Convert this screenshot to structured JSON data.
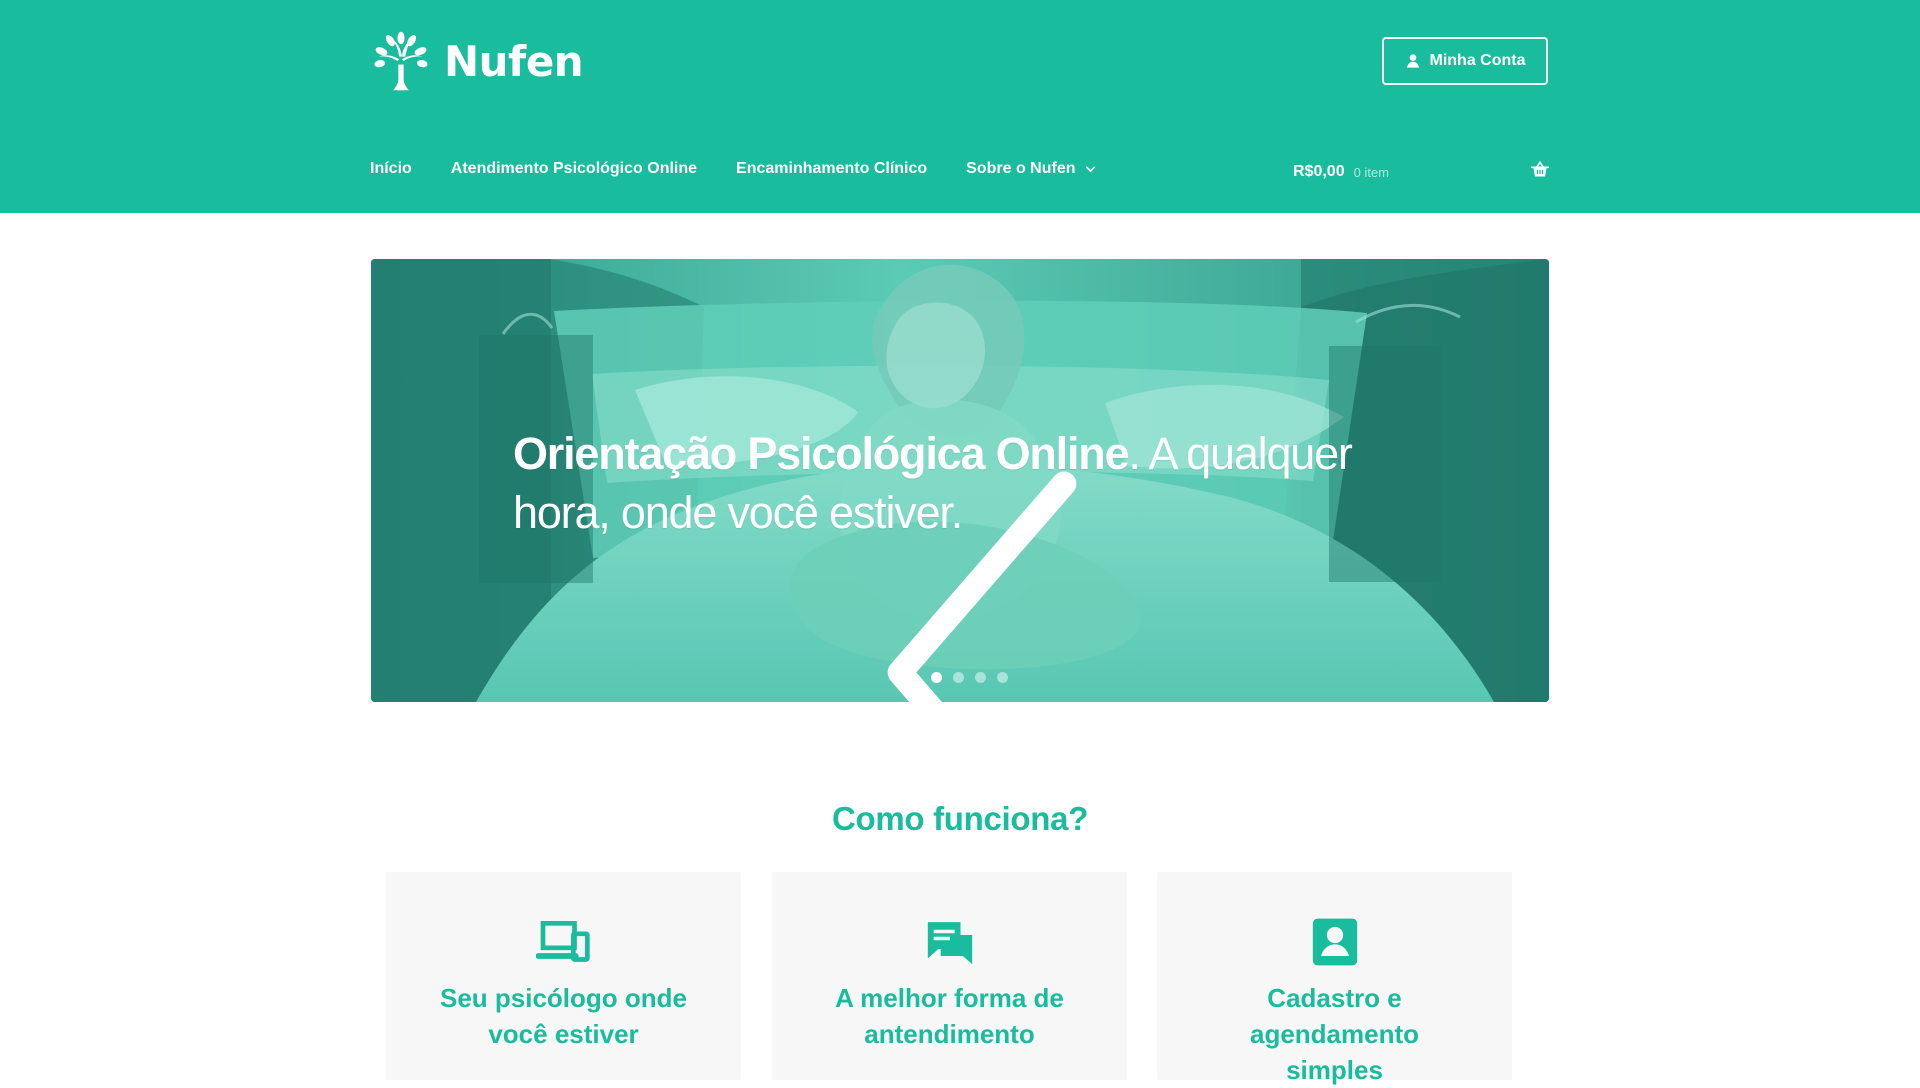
{
  "brand": {
    "name": "Nufen",
    "logo_icon": "tree-icon"
  },
  "header": {
    "account_button": {
      "label": "Minha Conta",
      "icon": "user-icon"
    },
    "nav": [
      {
        "label": "Início"
      },
      {
        "label": "Atendimento Psicológico Online"
      },
      {
        "label": "Encaminhamento Clínico"
      },
      {
        "label": "Sobre o Nufen",
        "dropdown_icon": "chevron-down-icon"
      }
    ],
    "cart": {
      "total": "R$0,00",
      "count": "0 item",
      "icon": "shopping-basket-icon"
    }
  },
  "hero": {
    "title_strong": "Orientação Psicológica Online",
    "title_rest": ". A qualquer hora, onde você estiver.",
    "left_icon": "chevron-left-icon",
    "right_icon": "chevron-right-icon",
    "slides": 4,
    "active_slide": 1
  },
  "how_it_works": {
    "title": "Como funciona?",
    "cards": [
      {
        "icon": "devices-icon",
        "label": "Seu psicólogo onde\nvocê estiver"
      },
      {
        "icon": "chat-icon",
        "label": "A melhor forma de\nantendimento"
      },
      {
        "icon": "account-box-icon",
        "label": "Cadastro e\nagendamento simples"
      }
    ]
  },
  "colors": {
    "primary": "#19bc9c",
    "card_background": "#f7f7f7",
    "text_on_primary": "#ffffff"
  }
}
